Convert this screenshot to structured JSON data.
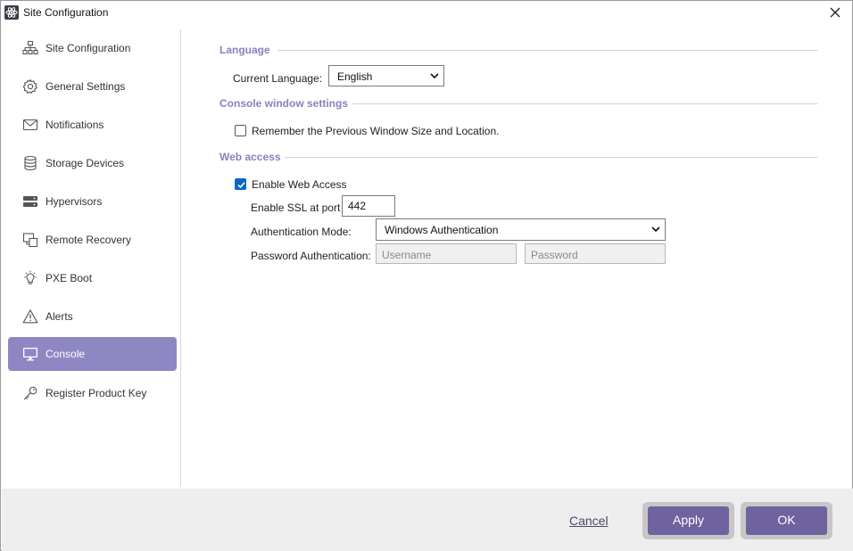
{
  "window": {
    "title": "Site Configuration",
    "app_icon": "atom-icon",
    "close_icon": "close-icon"
  },
  "sidebar": {
    "items": [
      {
        "label": "Site Configuration",
        "icon": "sitemap-icon",
        "active": false
      },
      {
        "label": "General Settings",
        "icon": "gear-icon",
        "active": false
      },
      {
        "label": "Notifications",
        "icon": "envelope-icon",
        "active": false
      },
      {
        "label": "Storage Devices",
        "icon": "database-icon",
        "active": false
      },
      {
        "label": "Hypervisors",
        "icon": "server-icon",
        "active": false
      },
      {
        "label": "Remote Recovery",
        "icon": "remote-recovery-icon",
        "active": false
      },
      {
        "label": "PXE Boot",
        "icon": "lightbulb-icon",
        "active": false
      },
      {
        "label": "Alerts",
        "icon": "warning-icon",
        "active": false
      },
      {
        "label": "Console",
        "icon": "monitor-icon",
        "active": true
      },
      {
        "label": "Register Product Key",
        "icon": "key-icon",
        "active": false
      }
    ]
  },
  "language": {
    "section_title": "Language",
    "current_language_label": "Current Language:",
    "current_language_value": "English"
  },
  "console_window": {
    "section_title": "Console window settings",
    "remember_label": "Remember the Previous Window Size and Location.",
    "remember_checked": false
  },
  "web_access": {
    "section_title": "Web access",
    "enable_label": "Enable Web Access",
    "enable_checked": true,
    "ssl_label": "Enable SSL at port",
    "ssl_port": "442",
    "auth_mode_label": "Authentication Mode:",
    "auth_mode_value": "Windows Authentication",
    "password_auth_label": "Password Authentication:",
    "username_placeholder": "Username",
    "password_placeholder": "Password"
  },
  "footer": {
    "cancel_label": "Cancel",
    "apply_label": "Apply",
    "ok_label": "OK"
  },
  "colors": {
    "accent": "#8a80bf",
    "active_nav": "#8f87c4",
    "button": "#70619f",
    "checkbox": "#0a67c6"
  }
}
